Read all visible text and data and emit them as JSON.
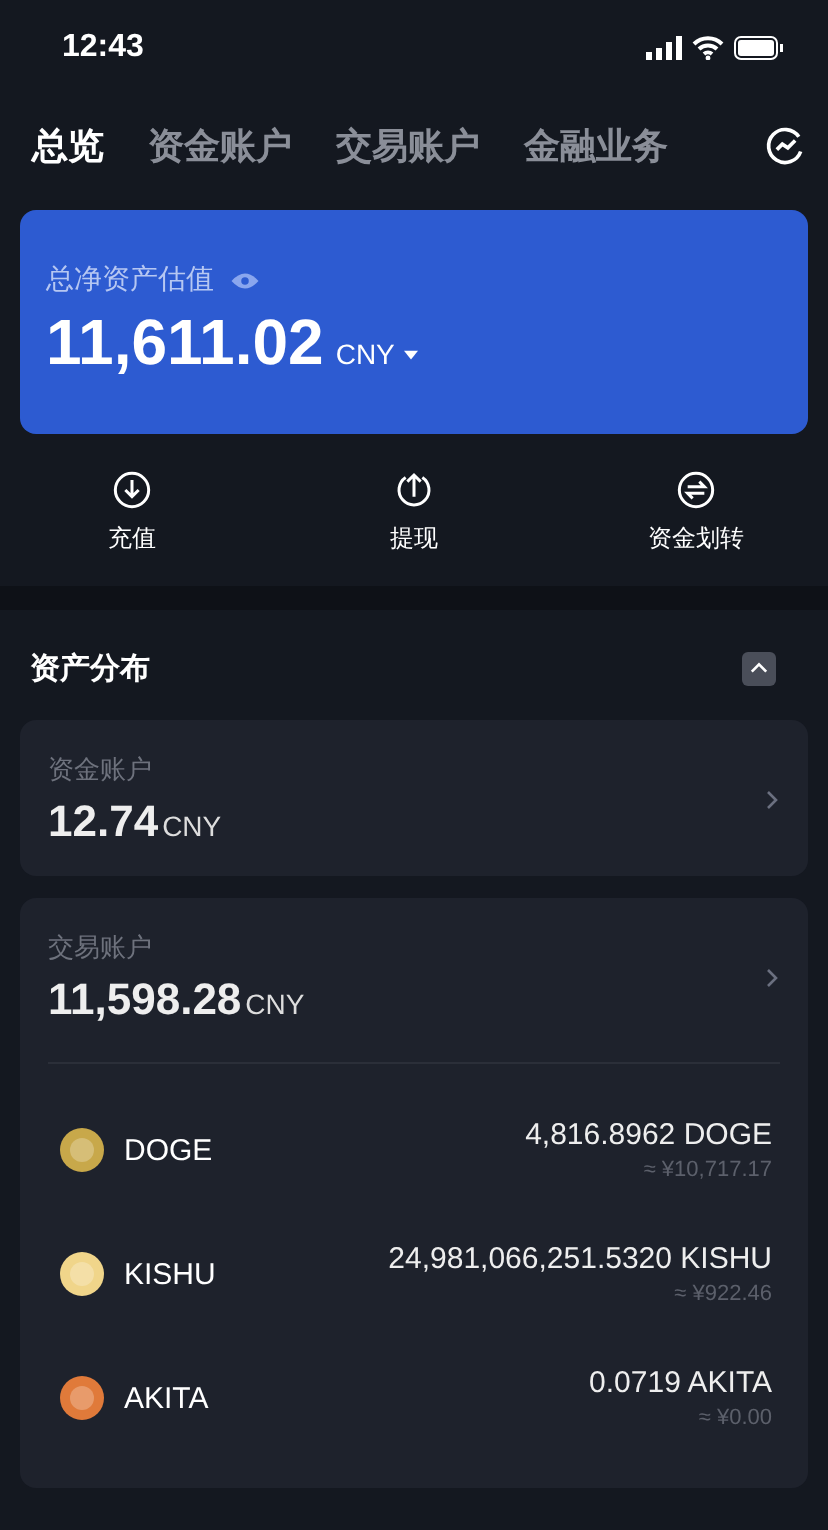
{
  "status_bar": {
    "time": "12:43"
  },
  "tabs": [
    {
      "label": "总览",
      "selected": true
    },
    {
      "label": "资金账户",
      "selected": false
    },
    {
      "label": "交易账户",
      "selected": false
    },
    {
      "label": "金融业务",
      "selected": false
    }
  ],
  "summary": {
    "label": "总净资产估值",
    "amount": "11,611.02",
    "currency": "CNY"
  },
  "actions": [
    {
      "kind": "deposit",
      "label": "充值"
    },
    {
      "kind": "withdraw",
      "label": "提现"
    },
    {
      "kind": "transfer",
      "label": "资金划转"
    }
  ],
  "distribution": {
    "title": "资产分布",
    "expanded": true,
    "accounts": [
      {
        "label": "资金账户",
        "amount": "12.74",
        "currency": "CNY"
      },
      {
        "label": "交易账户",
        "amount": "11,598.28",
        "currency": "CNY",
        "assets": [
          {
            "symbol": "DOGE",
            "color": "#c8a84a",
            "balance": "4,816.8962 DOGE",
            "value": "≈ ¥10,717.17"
          },
          {
            "symbol": "KISHU",
            "color": "#f0d58a",
            "balance": "24,981,066,251.5320 KISHU",
            "value": "≈ ¥922.46"
          },
          {
            "symbol": "AKITA",
            "color": "#e07a3a",
            "balance": "0.0719 AKITA",
            "value": "≈ ¥0.00"
          }
        ]
      }
    ]
  }
}
